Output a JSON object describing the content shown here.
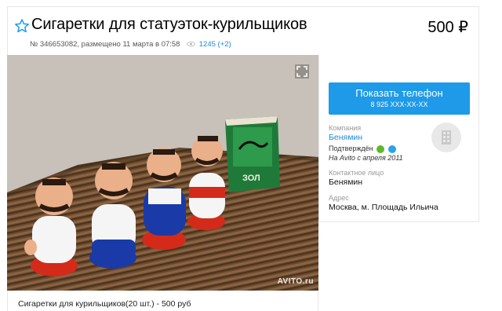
{
  "listing": {
    "title": "Сигаретки для статуэток-курильщиков",
    "price": "500 ₽",
    "meta_text": "№ 346653082, размещено 11 марта в 07:58",
    "views": "1245 (+2)"
  },
  "photo": {
    "watermark": "AVITO.ru",
    "caption": "Сигаретки для курильщиков(20 шт.) - 500 руб"
  },
  "seller": {
    "phone_button": "Показать телефон",
    "phone_mask": "8 925 XXX-XX-XX",
    "company_label": "Компания",
    "company_name": "Бенямин",
    "confirmed_text": "Подтверждён",
    "on_avito_since": "На Avito с апреля 2011",
    "contact_label": "Контактное лицо",
    "contact_name": "Бенямин",
    "address_label": "Адрес",
    "address": "Москва, м. Площадь Ильича"
  },
  "colors": {
    "accent": "#1e9ae8",
    "link": "#1b8ae0",
    "phone_verified": "#5cb82a",
    "web_verified": "#2aa3e8"
  },
  "icons": {
    "favorite": "star-outline-icon",
    "views": "eye-icon",
    "fullscreen": "fullscreen-icon",
    "company_avatar": "building-icon",
    "verified_phone": "phone-check-icon",
    "verified_web": "globe-check-icon"
  }
}
